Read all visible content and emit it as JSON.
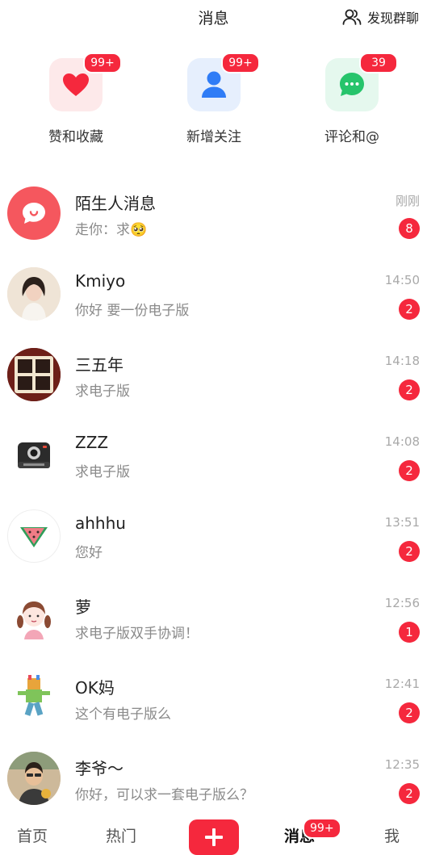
{
  "header": {
    "title": "消息",
    "discover_label": "发现群聊"
  },
  "tiles": [
    {
      "label": "赞和收藏",
      "badge": "99+",
      "icon": "heart-icon",
      "color": "#f5283d"
    },
    {
      "label": "新增关注",
      "badge": "99+",
      "icon": "person-icon",
      "color": "#2f7cf6"
    },
    {
      "label": "评论和@",
      "badge": "39",
      "icon": "chat-bubble-icon",
      "color": "#26c46b"
    }
  ],
  "conversations": [
    {
      "name": "陌生人消息",
      "preview": "走你：求🥺",
      "time": "刚刚",
      "unread": "8",
      "avatar": "stranger-chat-icon"
    },
    {
      "name": "Kmiyo",
      "preview": "你好 要一份电子版",
      "time": "14:50",
      "unread": "2",
      "avatar": "user-photo"
    },
    {
      "name": "三五年",
      "preview": "求电子版",
      "time": "14:18",
      "unread": "2",
      "avatar": "calligraphy-sign"
    },
    {
      "name": "ZZZ",
      "preview": "求电子版",
      "time": "14:08",
      "unread": "2",
      "avatar": "camera-icon"
    },
    {
      "name": "ahhhu",
      "preview": "您好",
      "time": "13:51",
      "unread": "2",
      "avatar": "watermelon-icon"
    },
    {
      "name": "萝",
      "preview": "求电子版双手协调！",
      "time": "12:56",
      "unread": "1",
      "avatar": "girl-drawing"
    },
    {
      "name": "OK妈",
      "preview": "这个有电子版么",
      "time": "12:41",
      "unread": "2",
      "avatar": "cartoon-figure"
    },
    {
      "name": "李爷～",
      "preview": "你好，可以求一套电子版么？",
      "time": "12:35",
      "unread": "2",
      "avatar": "user-photo"
    }
  ],
  "tabbar": {
    "home": "首页",
    "trending": "热门",
    "messages": "消息",
    "messages_badge": "99+",
    "me": "我"
  },
  "colors": {
    "accent": "#f5283d"
  }
}
